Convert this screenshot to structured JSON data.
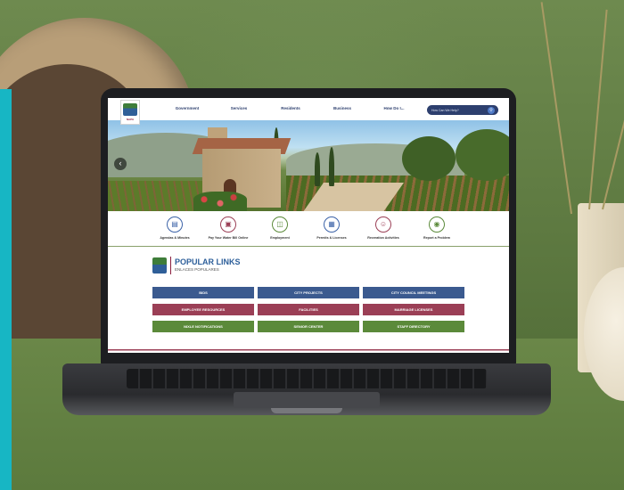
{
  "site": {
    "logo_word": "NAPA",
    "nav": [
      "Government",
      "Services",
      "Residents",
      "Business",
      "How Do I..."
    ],
    "search": {
      "placeholder": "How Can We Help?"
    }
  },
  "quick_links": [
    {
      "label": "Agendas & Minutes",
      "icon": "document-icon",
      "color": "#3c63a8"
    },
    {
      "label": "Pay Your Water Bill Online",
      "icon": "payment-icon",
      "color": "#9b3f56"
    },
    {
      "label": "Employment",
      "icon": "briefcase-icon",
      "color": "#5b8a3a"
    },
    {
      "label": "Permits & Licenses",
      "icon": "permit-icon",
      "color": "#3c63a8"
    },
    {
      "label": "Recreation Activities",
      "icon": "recreation-icon",
      "color": "#9b3f56"
    },
    {
      "label": "Report a Problem",
      "icon": "eye-icon",
      "color": "#5b8a3a"
    }
  ],
  "popular": {
    "title": "POPULAR LINKS",
    "subtitle": "ENLACES POPULARES",
    "buttons": [
      {
        "label": "BIDS",
        "color": "#3b5a8f"
      },
      {
        "label": "CITY PROJECTS",
        "color": "#3b5a8f"
      },
      {
        "label": "CITY COUNCIL MEETINGS",
        "color": "#3b5a8f"
      },
      {
        "label": "EMPLOYEE RESOURCES",
        "color": "#9b3f56"
      },
      {
        "label": "FACILITIES",
        "color": "#9b3f56"
      },
      {
        "label": "MARRIAGE LICENSES",
        "color": "#9b3f56"
      },
      {
        "label": "NIXLE NOTIFICATIONS",
        "color": "#5b8a3a"
      },
      {
        "label": "SENIOR CENTER",
        "color": "#5b8a3a"
      },
      {
        "label": "STAFF DIRECTORY",
        "color": "#5b8a3a"
      }
    ]
  },
  "colors": {
    "accent_cyan": "#17b6c4",
    "navy": "#2d3f6e",
    "wall_green": "#6e8a4f"
  }
}
